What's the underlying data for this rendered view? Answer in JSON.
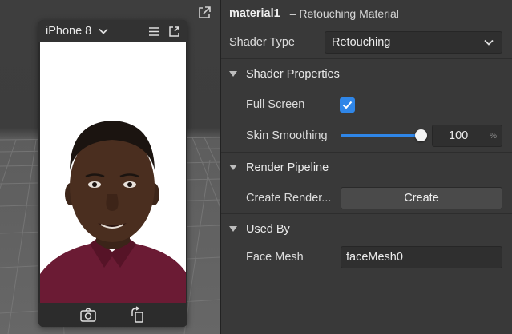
{
  "viewport": {
    "device_name": "iPhone 8",
    "icons": [
      "expand-icon",
      "chevron-down-icon",
      "hamburger-menu-icon",
      "popout-icon",
      "switch-camera-icon",
      "rotate-device-icon"
    ]
  },
  "inspector": {
    "material_name": "material1",
    "material_subtitle": "– Retouching Material",
    "shader_type": {
      "label": "Shader Type",
      "value": "Retouching"
    },
    "sections": {
      "shader_properties": "Shader Properties",
      "render_pipeline": "Render Pipeline",
      "used_by": "Used By"
    },
    "full_screen": {
      "label": "Full Screen",
      "checked": true
    },
    "skin_smoothing": {
      "label": "Skin Smoothing",
      "value": "100",
      "unit": "%",
      "fraction": 1.0
    },
    "create_render": {
      "label": "Create Render...",
      "button": "Create"
    },
    "face_mesh": {
      "label": "Face Mesh",
      "value": "faceMesh0"
    }
  },
  "colors": {
    "accent": "#2f86e8",
    "panel_bg": "#393939",
    "field_bg": "#2f2f2f"
  }
}
